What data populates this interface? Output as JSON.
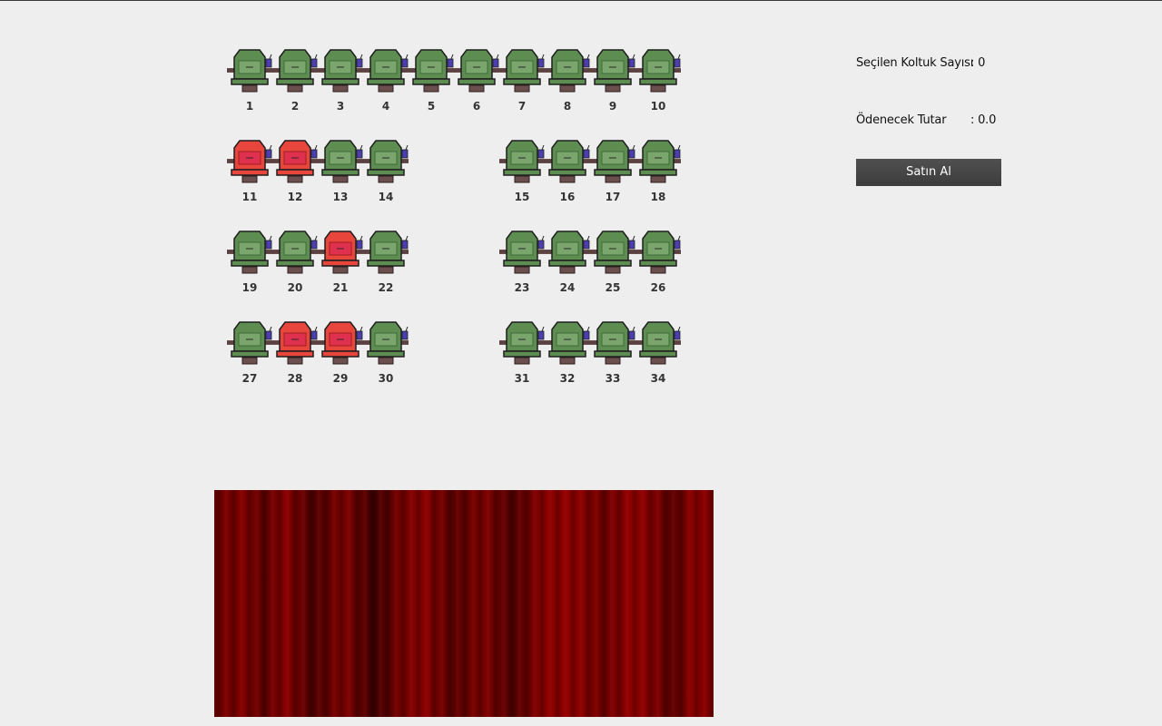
{
  "info": {
    "selected_label": "Seçilen Koltuk Sayısı",
    "selected_value": ": 0",
    "amount_label": "Ödenecek Tutar",
    "amount_value": ": 0.0",
    "buy_label": "Satın Al"
  },
  "colors": {
    "available": "#5e8d52",
    "occupied": "#e8453c",
    "curtain": "#7a0000",
    "button": "#454545"
  },
  "seats": [
    {
      "number": "1",
      "status": "available"
    },
    {
      "number": "2",
      "status": "available"
    },
    {
      "number": "3",
      "status": "available"
    },
    {
      "number": "4",
      "status": "available"
    },
    {
      "number": "5",
      "status": "available"
    },
    {
      "number": "6",
      "status": "available"
    },
    {
      "number": "7",
      "status": "available"
    },
    {
      "number": "8",
      "status": "available"
    },
    {
      "number": "9",
      "status": "available"
    },
    {
      "number": "10",
      "status": "available"
    },
    {
      "number": "11",
      "status": "occupied"
    },
    {
      "number": "12",
      "status": "occupied"
    },
    {
      "number": "13",
      "status": "available"
    },
    {
      "number": "14",
      "status": "available"
    },
    {
      "number": "15",
      "status": "available"
    },
    {
      "number": "16",
      "status": "available"
    },
    {
      "number": "17",
      "status": "available"
    },
    {
      "number": "18",
      "status": "available"
    },
    {
      "number": "19",
      "status": "available"
    },
    {
      "number": "20",
      "status": "available"
    },
    {
      "number": "21",
      "status": "occupied"
    },
    {
      "number": "22",
      "status": "available"
    },
    {
      "number": "23",
      "status": "available"
    },
    {
      "number": "24",
      "status": "available"
    },
    {
      "number": "25",
      "status": "available"
    },
    {
      "number": "26",
      "status": "available"
    },
    {
      "number": "27",
      "status": "available"
    },
    {
      "number": "28",
      "status": "occupied"
    },
    {
      "number": "29",
      "status": "occupied"
    },
    {
      "number": "30",
      "status": "available"
    },
    {
      "number": "31",
      "status": "available"
    },
    {
      "number": "32",
      "status": "available"
    },
    {
      "number": "33",
      "status": "available"
    },
    {
      "number": "34",
      "status": "available"
    }
  ]
}
